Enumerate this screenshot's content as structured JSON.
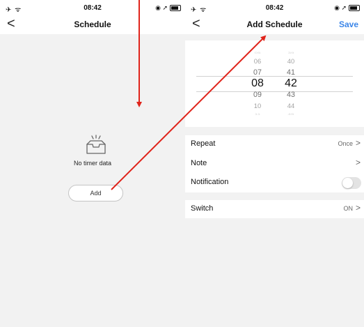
{
  "left_screen": {
    "status": {
      "left_icons": "✈ ᯤ",
      "time": "08:42",
      "right_icons": "◉ ➚"
    },
    "nav": {
      "back": "<",
      "title": "Schedule"
    },
    "empty_state": {
      "text": "No timer data",
      "icon": "empty-tray-icon"
    },
    "add_button": "Add"
  },
  "right_screen": {
    "status": {
      "left_icons": "✈ ᯤ",
      "time": "08:42",
      "right_icons": "◉ ➚"
    },
    "nav": {
      "back": "<",
      "title": "Add Schedule",
      "save": "Save"
    },
    "picker": {
      "hours": [
        "05",
        "06",
        "07",
        "08",
        "09",
        "10",
        "11"
      ],
      "minutes": [
        "39",
        "40",
        "41",
        "42",
        "43",
        "44",
        "45"
      ],
      "selected_hour": "08",
      "selected_minute": "42"
    },
    "rows": [
      {
        "label": "Repeat",
        "value": "Once",
        "chevron": ">"
      },
      {
        "label": "Note",
        "value": "",
        "chevron": ">"
      },
      {
        "label": "Notification",
        "toggle": false
      }
    ],
    "switch_row": {
      "label": "Switch",
      "value": "ON",
      "chevron": ">"
    }
  },
  "annotations": {
    "arrow_color": "#e0241b"
  },
  "colors": {
    "accent": "#3c86e8",
    "background": "#f2f2f2"
  }
}
